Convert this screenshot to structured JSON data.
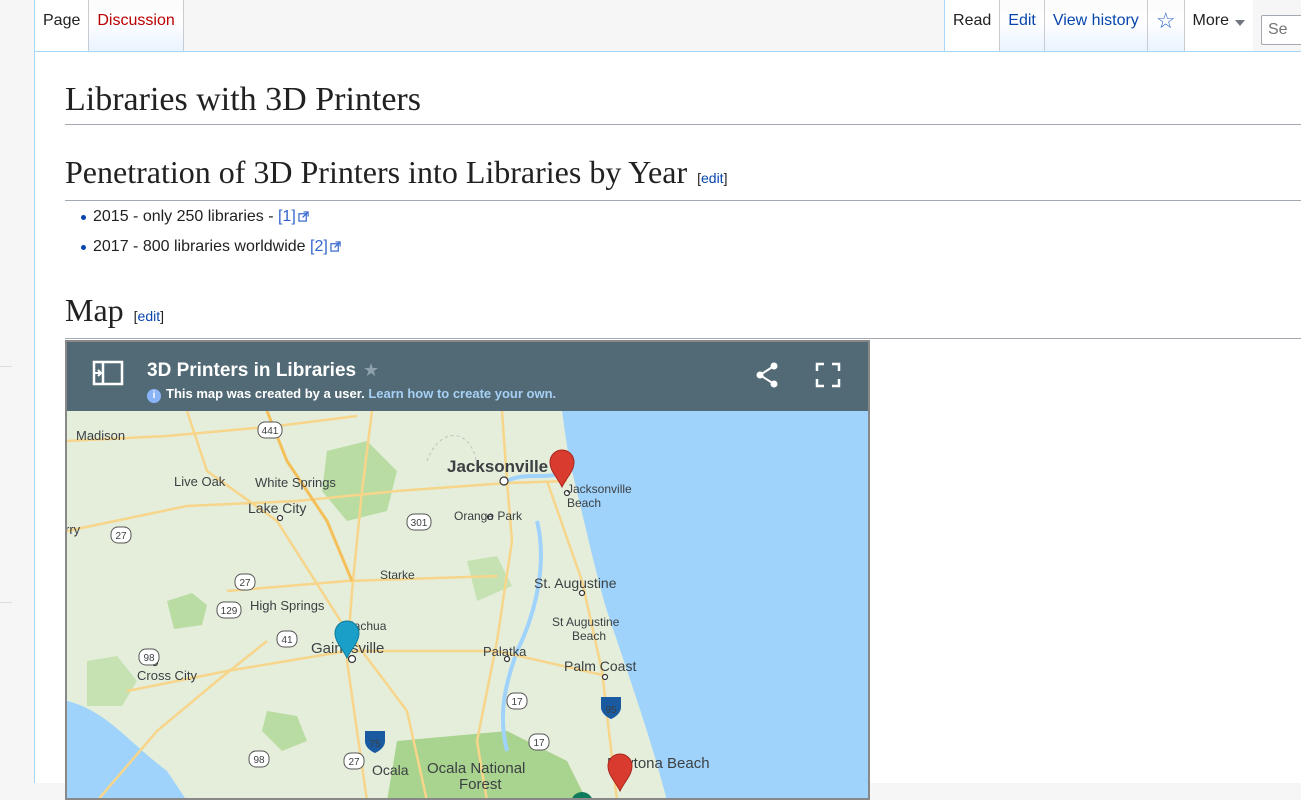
{
  "tabs_left": [
    {
      "label": "Page",
      "selected": true
    },
    {
      "label": "Discussion",
      "selected": false
    }
  ],
  "tabs_right": {
    "read": "Read",
    "edit": "Edit",
    "view_history": "View history",
    "more": "More",
    "search_placeholder": "Se"
  },
  "article": {
    "title": "Libraries with 3D Printers",
    "section1": {
      "heading": "Penetration of 3D Printers into Libraries by Year",
      "edit_label": "edit",
      "items": [
        {
          "text": "2015 - only 250 libraries - ",
          "ref": "[1]"
        },
        {
          "text": "2017 - 800 libraries worldwide ",
          "ref": "[2]"
        }
      ]
    },
    "section2": {
      "heading": "Map",
      "edit_label": "edit"
    }
  },
  "map": {
    "title": "3D Printers in Libraries",
    "subtitle": "This map was created by a user.",
    "learn_link": "Learn how to create your own.",
    "places": {
      "jacksonville": "Jacksonville",
      "jacksonville_beach_1": "Jacksonville",
      "jacksonville_beach_2": "Beach",
      "orange_park": "Orange Park",
      "st_augustine": "St. Augustine",
      "st_aug_beach_1": "St Augustine",
      "st_aug_beach_2": "Beach",
      "palm_coast": "Palm Coast",
      "palatka": "Palatka",
      "gainesville": "Gainesville",
      "alachua": "Alachua",
      "high_springs": "High Springs",
      "starke": "Starke",
      "lake_city": "Lake City",
      "live_oak": "Live Oak",
      "white_springs": "White Springs",
      "madison": "Madison",
      "cross_city": "Cross City",
      "ocala": "Ocala",
      "ocala_nf_1": "Ocala National",
      "ocala_nf_2": "Forest",
      "daytona_beach": "Daytona Beach",
      "perry_partial": "rry"
    },
    "shields": [
      "441",
      "301",
      "27",
      "27",
      "129",
      "41",
      "98",
      "75",
      "17",
      "17",
      "95",
      "27",
      "98"
    ],
    "pin_colors": {
      "red": "#d93b2f",
      "teal": "#1aa0c8"
    },
    "colors": {
      "water": "#9fd3fb",
      "land": "#e4eedb",
      "forest": "#b9dca3",
      "road": "#f7d58a"
    }
  }
}
